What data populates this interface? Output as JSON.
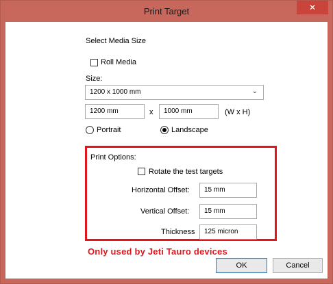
{
  "window": {
    "title": "Print Target",
    "close_icon": "close-icon"
  },
  "media": {
    "heading": "Select Media Size",
    "roll_media_label": "Roll Media",
    "size_label": "Size:",
    "size_selected": "1200 x 1000 mm",
    "width_value": "1200 mm",
    "x_label": "x",
    "height_value": "1000 mm",
    "wh_label": "(W x H)",
    "portrait_label": "Portrait",
    "landscape_label": "Landscape",
    "orientation_selected": "Landscape"
  },
  "print_options": {
    "heading": "Print Options:",
    "rotate_label": "Rotate the test targets",
    "horizontal_offset_label": "Horizontal Offset:",
    "horizontal_offset_value": "15 mm",
    "vertical_offset_label": "Vertical Offset:",
    "vertical_offset_value": "15 mm",
    "thickness_label": "Thickness",
    "thickness_value": "125 micron"
  },
  "annotation": {
    "note": "Only used by Jeti Tauro devices",
    "color": "#e0161c"
  },
  "buttons": {
    "ok": "OK",
    "cancel": "Cancel"
  }
}
